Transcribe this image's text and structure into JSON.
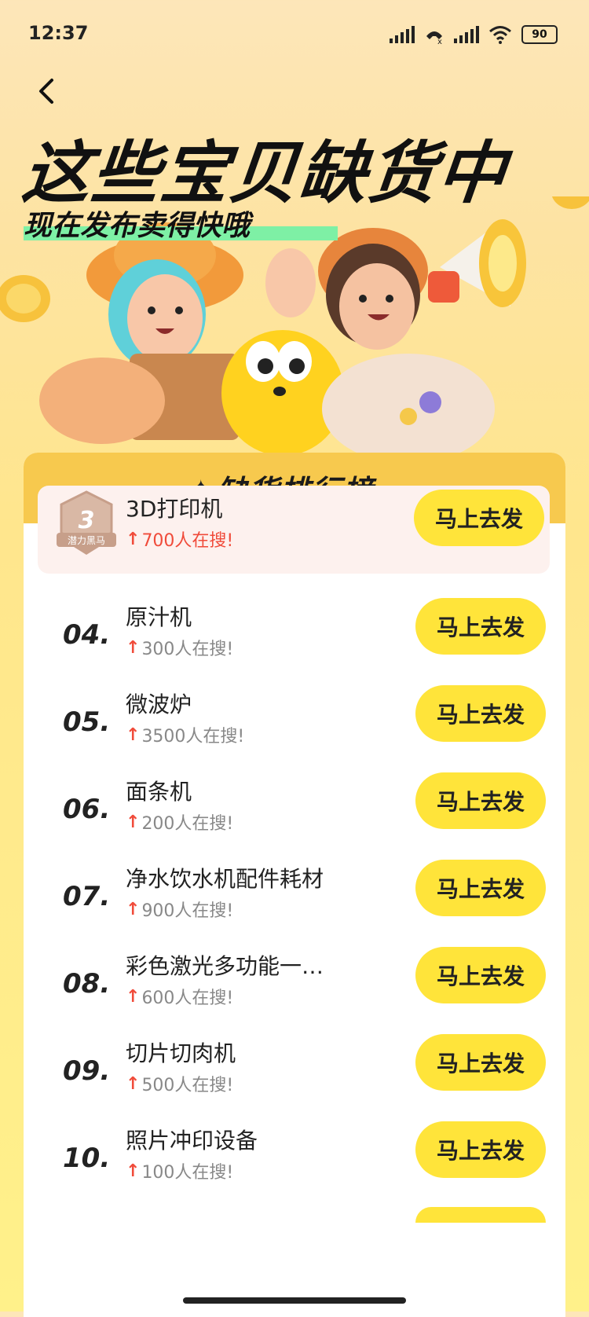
{
  "status_bar": {
    "time": "12:37",
    "battery": "90"
  },
  "hero": {
    "title": "这些宝贝缺货中",
    "subtitle": "现在发布卖得快哦"
  },
  "ranking": {
    "title": "缺货排行榜",
    "button_label": "马上去发",
    "items": [
      {
        "rank": "",
        "badge_rank": "3",
        "badge_text": "潜力黑马",
        "name": "3D打印机",
        "hot": "700人在搜!"
      },
      {
        "rank": "04.",
        "name": "原汁机",
        "hot": "300人在搜!"
      },
      {
        "rank": "05.",
        "name": "微波炉",
        "hot": "3500人在搜!"
      },
      {
        "rank": "06.",
        "name": "面条机",
        "hot": "200人在搜!"
      },
      {
        "rank": "07.",
        "name": "净水饮水机配件耗材",
        "hot": "900人在搜!"
      },
      {
        "rank": "08.",
        "name": "彩色激光多功能一…",
        "hot": "600人在搜!"
      },
      {
        "rank": "09.",
        "name": "切片切肉机",
        "hot": "500人在搜!"
      },
      {
        "rank": "10.",
        "name": "照片冲印设备",
        "hot": "100人在搜!"
      }
    ]
  },
  "colors": {
    "accent": "#FFE43A",
    "card_header": "#F7C94E",
    "hot_red": "#F04B3A",
    "highlight_bg": "#FDF1EE"
  }
}
